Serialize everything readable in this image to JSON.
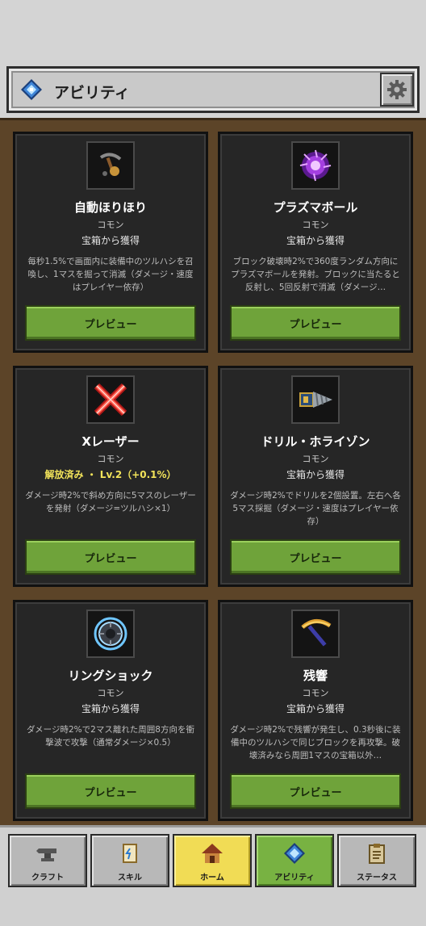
{
  "header": {
    "title": "アビリティ"
  },
  "abilities": [
    {
      "name": "自動ほりほり",
      "rarity": "コモン",
      "source": "宝箱から獲得",
      "desc": "毎秒1.5%で画面内に装備中のツルハシを召喚し、1マスを掘って消滅（ダメージ・速度はプレイヤー依存）",
      "button": "プレビュー",
      "icon": "auto-dig-icon"
    },
    {
      "name": "プラズマボール",
      "rarity": "コモン",
      "source": "宝箱から獲得",
      "desc": "ブロック破壊時2%で360度ランダム方向にプラズマボールを発射。ブロックに当たると反射し、5回反射で消滅（ダメージ…",
      "button": "プレビュー",
      "icon": "plasma-ball-icon"
    },
    {
      "name": "Xレーザー",
      "rarity": "コモン",
      "source": "解放済み ・ Lv.2（+0.1%）",
      "desc": "ダメージ時2%で斜め方向に5マスのレーザーを発射（ダメージ=ツルハシ×1）",
      "button": "プレビュー",
      "icon": "x-laser-icon"
    },
    {
      "name": "ドリル・ホライゾン",
      "rarity": "コモン",
      "source": "宝箱から獲得",
      "desc": "ダメージ時2%でドリルを2個設置。左右へ各5マス採掘（ダメージ・速度はプレイヤー依存）",
      "button": "プレビュー",
      "icon": "drill-icon"
    },
    {
      "name": "リングショック",
      "rarity": "コモン",
      "source": "宝箱から獲得",
      "desc": "ダメージ時2%で2マス離れた周囲8方向を衝撃波で攻撃（通常ダメージ×0.5）",
      "button": "プレビュー",
      "icon": "ring-shock-icon"
    },
    {
      "name": "残響",
      "rarity": "コモン",
      "source": "宝箱から獲得",
      "desc": "ダメージ時2%で残響が発生し、0.3秒後に装備中のツルハシで同じブロックを再攻撃。破壊済みなら周囲1マスの宝箱以外…",
      "button": "プレビュー",
      "icon": "pickaxe-icon"
    }
  ],
  "nav": [
    {
      "label": "クラフト",
      "icon": "anvil-icon"
    },
    {
      "label": "スキル",
      "icon": "scroll-icon"
    },
    {
      "label": "ホーム",
      "icon": "house-icon"
    },
    {
      "label": "アビリティ",
      "icon": "gem-icon"
    },
    {
      "label": "ステータス",
      "icon": "clipboard-icon"
    }
  ]
}
